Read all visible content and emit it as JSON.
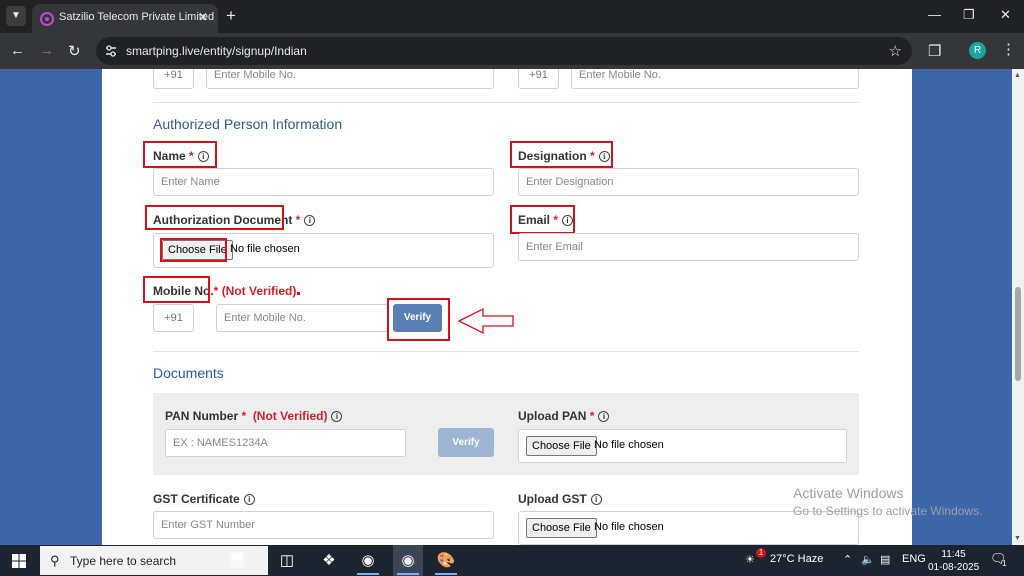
{
  "browser": {
    "tab_title": "Satzilio Telecom Private Limited",
    "url": "smartping.live/entity/signup/Indian",
    "profile_initial": "R",
    "icons": [
      "chevron-down-icon",
      "close-icon",
      "plus-icon",
      "minimize-icon",
      "restore-icon",
      "back-icon",
      "forward-icon",
      "reload-icon",
      "site-settings-icon",
      "star-icon",
      "extensions-icon",
      "menu-icon"
    ]
  },
  "form": {
    "top_row": {
      "prefix_left": "+91",
      "mobile_left_placeholder": "Enter Mobile No.",
      "prefix_right": "+91",
      "mobile_right_placeholder": "Enter Mobile No."
    },
    "authorized": {
      "title": "Authorized Person Information",
      "name_label": "Name",
      "name_placeholder": "Enter Name",
      "designation_label": "Designation",
      "designation_placeholder": "Enter Designation",
      "auth_doc_label": "Authorization Document",
      "choose_file": "Choose File",
      "no_file": "No file chosen",
      "email_label": "Email",
      "email_placeholder": "Enter Email",
      "mobile_label": "Mobile No.",
      "not_verified": "(Not Verified)",
      "prefix": "+91",
      "mobile_placeholder": "Enter Mobile No.",
      "verify": "Verify"
    },
    "documents": {
      "title": "Documents",
      "pan_label": "PAN Number",
      "pan_not_verified": "(Not Verified)",
      "pan_placeholder": "EX : NAMES1234A",
      "pan_verify": "Verify",
      "upload_pan_label": "Upload PAN",
      "choose_file": "Choose File",
      "no_file": "No file chosen",
      "gst_label": "GST Certificate",
      "gst_placeholder": "Enter GST Number",
      "upload_gst_label": "Upload GST",
      "gst_choose_file": "Choose File",
      "gst_no_file": "No file chosen"
    },
    "required_mark": "*"
  },
  "watermark": {
    "line1": "Activate Windows",
    "line2": "Go to Settings to activate Windows."
  },
  "taskbar": {
    "search_placeholder": "Type here to search",
    "weather": "27°C  Haze",
    "weather_badge": "1",
    "language": "ENG",
    "time": "11:45",
    "date": "01-08-2025",
    "notification_count": "1"
  },
  "colors": {
    "accent_title": "#2e5b9a",
    "required": "#d0202a",
    "verify_button": "#5a7fb4",
    "annotation_red": "#d4141c",
    "page_background": "#3d66a8"
  }
}
